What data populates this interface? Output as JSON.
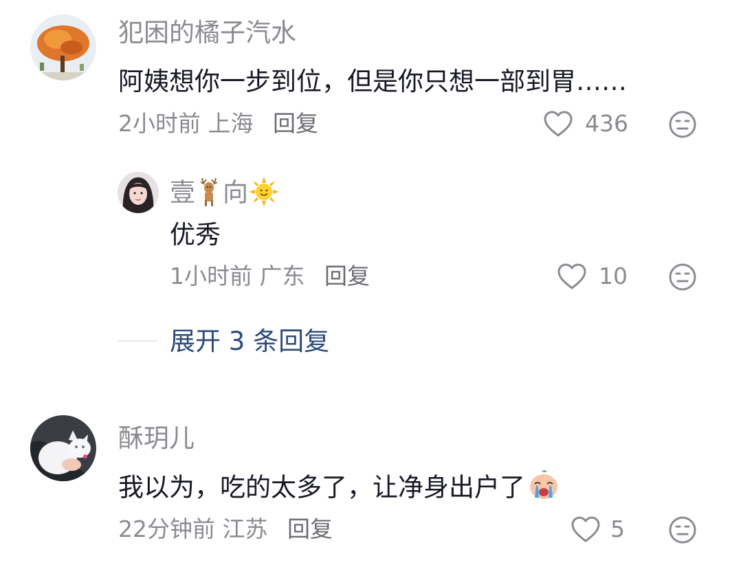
{
  "comments": [
    {
      "username": "犯困的橘子汽水",
      "text": "阿姨想你一步到位，但是你只想一部到胃……",
      "time": "2小时前",
      "location": "上海",
      "reply_label": "回复",
      "likes": "436",
      "avatar_icon": "orange-tree-avatar",
      "replies": [
        {
          "username_prefix": "壹",
          "username_middle": "向",
          "username_emojis": [
            "deer-icon",
            "sun-icon"
          ],
          "text": "优秀",
          "time": "1小时前",
          "location": "广东",
          "reply_label": "回复",
          "likes": "10",
          "avatar_icon": "girl-avatar"
        }
      ],
      "expand_label": "展开 3 条回复"
    },
    {
      "username": "酥玥儿",
      "text": "我以为，吃的太多了，让净身出户了",
      "text_emoji": "crying-face-icon",
      "time": "22分钟前",
      "location": "江苏",
      "reply_label": "回复",
      "likes": "5",
      "avatar_icon": "cat-avatar"
    }
  ],
  "colors": {
    "username": "#8a8b91",
    "text": "#161823",
    "link": "#2c4a7a"
  }
}
